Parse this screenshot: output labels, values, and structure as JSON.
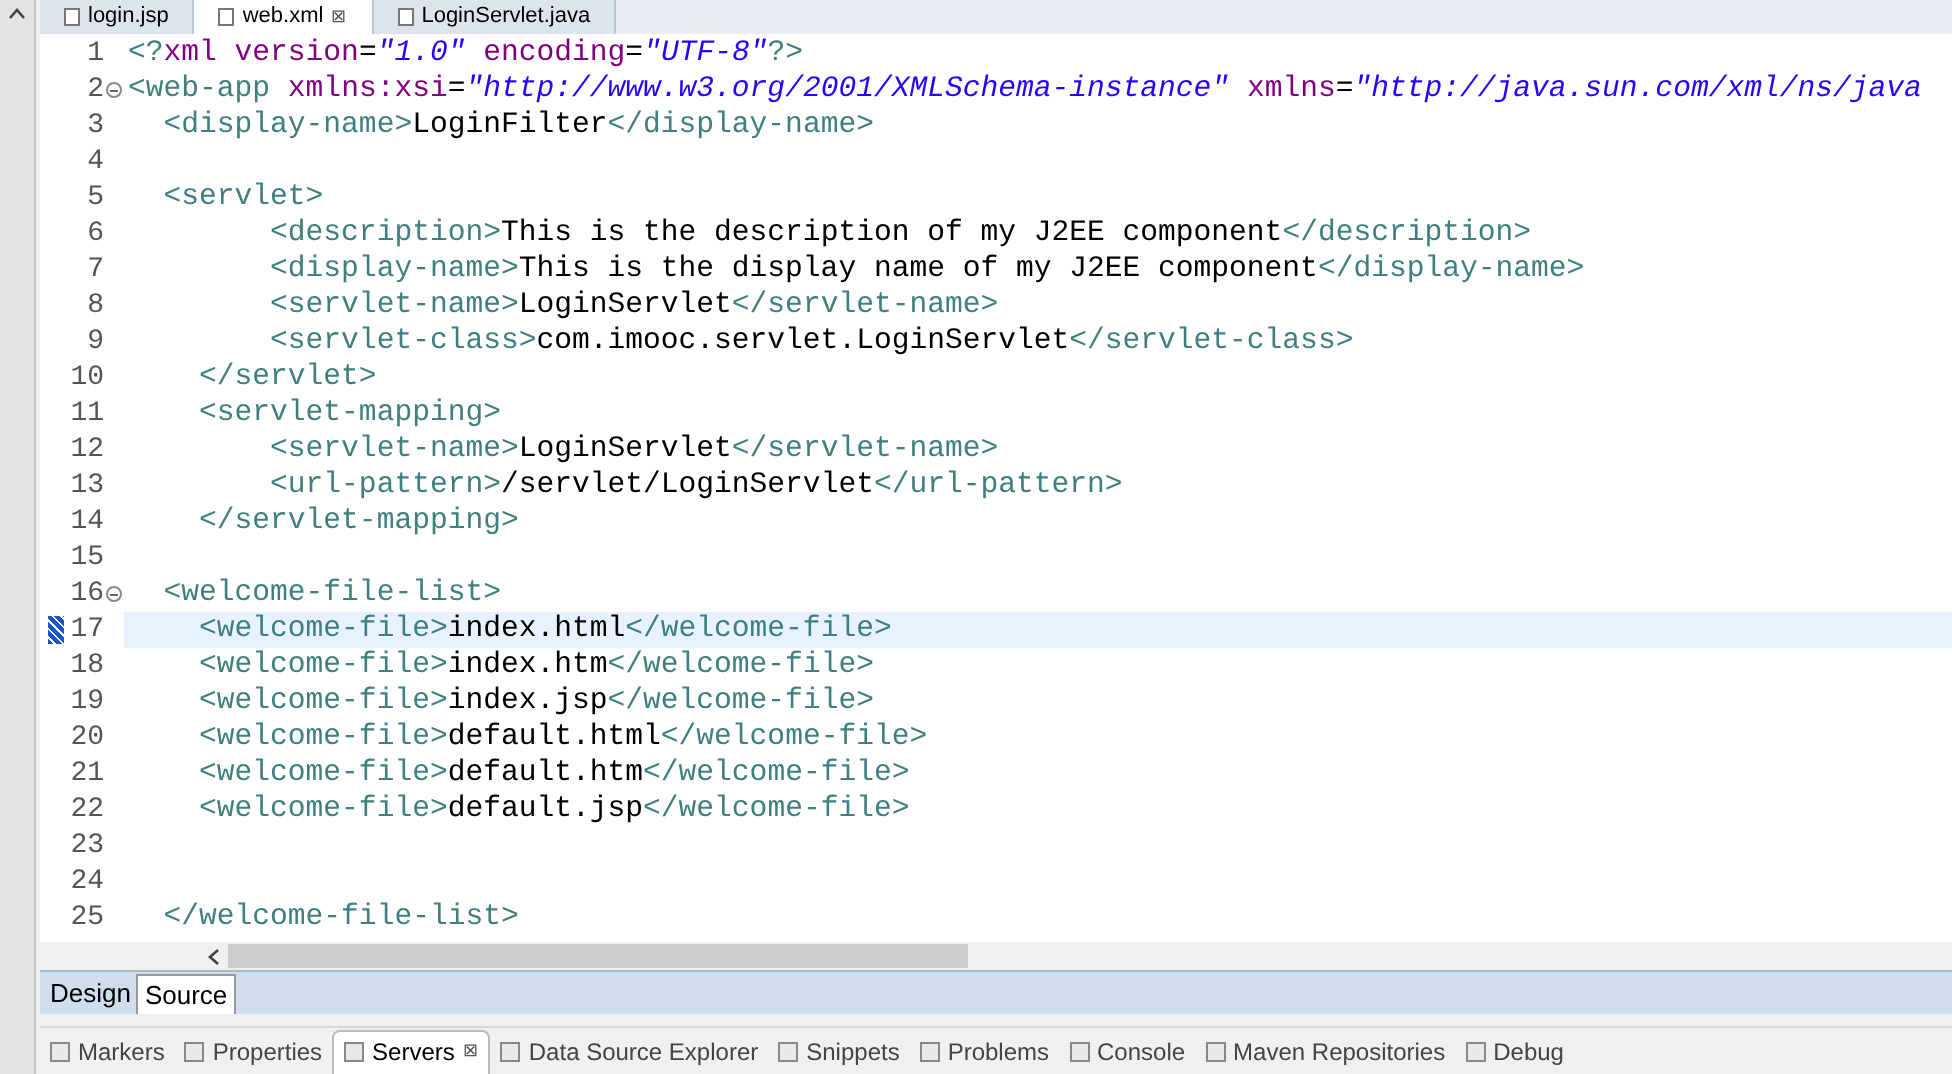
{
  "editor_tabs": [
    {
      "label": "login.jsp",
      "selected": false
    },
    {
      "label": "web.xml",
      "selected": true,
      "close": "⊠"
    },
    {
      "label": "LoginServlet.java",
      "selected": false
    }
  ],
  "lines": [
    {
      "number": "1",
      "fold": false,
      "current": false,
      "segments": [
        {
          "kind": "tag",
          "text": "<?"
        },
        {
          "kind": "attr",
          "text": "xml version"
        },
        {
          "kind": "plain",
          "text": "="
        },
        {
          "kind": "value",
          "text": "\"1.0\""
        },
        {
          "kind": "attr",
          "text": " encoding"
        },
        {
          "kind": "plain",
          "text": "="
        },
        {
          "kind": "value",
          "text": "\"UTF-8\""
        },
        {
          "kind": "tag",
          "text": "?>"
        }
      ]
    },
    {
      "number": "2",
      "fold": true,
      "current": false,
      "segments": [
        {
          "kind": "tag",
          "text": "<web-app"
        },
        {
          "kind": "attr",
          "text": " xmlns:xsi"
        },
        {
          "kind": "plain",
          "text": "="
        },
        {
          "kind": "value",
          "text": "\"http://www.w3.org/2001/XMLSchema-instance\""
        },
        {
          "kind": "attr",
          "text": " xmlns"
        },
        {
          "kind": "plain",
          "text": "="
        },
        {
          "kind": "value",
          "text": "\"http://java.sun.com/xml/ns/java"
        }
      ]
    },
    {
      "number": "3",
      "fold": false,
      "current": false,
      "segments": [
        {
          "kind": "tag",
          "text": "  <display-name>"
        },
        {
          "kind": "plain",
          "text": "LoginFilter"
        },
        {
          "kind": "tag",
          "text": "</display-name>"
        }
      ]
    },
    {
      "number": "4",
      "fold": false,
      "current": false
    },
    {
      "number": "5",
      "fold": false,
      "current": false,
      "segments": [
        {
          "kind": "tag",
          "text": "  <servlet>"
        }
      ]
    },
    {
      "number": "6",
      "fold": false,
      "current": false,
      "segments": [
        {
          "kind": "tag",
          "text": "        <description>"
        },
        {
          "kind": "plain",
          "text": "This is the description of my J2EE component"
        },
        {
          "kind": "tag",
          "text": "</description>"
        }
      ]
    },
    {
      "number": "7",
      "fold": false,
      "current": false,
      "segments": [
        {
          "kind": "tag",
          "text": "        <display-name>"
        },
        {
          "kind": "plain",
          "text": "This is the display name of my J2EE component"
        },
        {
          "kind": "tag",
          "text": "</display-name>"
        }
      ]
    },
    {
      "number": "8",
      "fold": false,
      "current": false,
      "segments": [
        {
          "kind": "tag",
          "text": "        <servlet-name>"
        },
        {
          "kind": "plain",
          "text": "LoginServlet"
        },
        {
          "kind": "tag",
          "text": "</servlet-name>"
        }
      ]
    },
    {
      "number": "9",
      "fold": false,
      "current": false,
      "segments": [
        {
          "kind": "tag",
          "text": "        <servlet-class>"
        },
        {
          "kind": "plain",
          "text": "com.imooc.servlet.LoginServlet"
        },
        {
          "kind": "tag",
          "text": "</servlet-class>"
        }
      ]
    },
    {
      "number": "10",
      "fold": false,
      "current": false,
      "segments": [
        {
          "kind": "tag",
          "text": "    </servlet>"
        }
      ]
    },
    {
      "number": "11",
      "fold": false,
      "current": false,
      "segments": [
        {
          "kind": "tag",
          "text": "    <servlet-mapping>"
        }
      ]
    },
    {
      "number": "12",
      "fold": false,
      "current": false,
      "segments": [
        {
          "kind": "tag",
          "text": "        <servlet-name>"
        },
        {
          "kind": "plain",
          "text": "LoginServlet"
        },
        {
          "kind": "tag",
          "text": "</servlet-name>"
        }
      ]
    },
    {
      "number": "13",
      "fold": false,
      "current": false,
      "segments": [
        {
          "kind": "tag",
          "text": "        <url-pattern>"
        },
        {
          "kind": "plain",
          "text": "/servlet/LoginServlet"
        },
        {
          "kind": "tag",
          "text": "</url-pattern>"
        }
      ]
    },
    {
      "number": "14",
      "fold": false,
      "current": false,
      "segments": [
        {
          "kind": "tag",
          "text": "    </servlet-mapping>"
        }
      ]
    },
    {
      "number": "15",
      "fold": false,
      "current": false
    },
    {
      "number": "16",
      "fold": true,
      "current": false,
      "segments": [
        {
          "kind": "tag",
          "text": "  <welcome-file-list>"
        }
      ]
    },
    {
      "number": "17",
      "fold": false,
      "current": true,
      "segments": [
        {
          "kind": "tag",
          "text": "    <welcome-file>"
        },
        {
          "kind": "plain",
          "text": "index.html"
        },
        {
          "kind": "tag",
          "text": "</welcome-file>"
        }
      ]
    },
    {
      "number": "18",
      "fold": false,
      "current": false,
      "segments": [
        {
          "kind": "tag",
          "text": "    <welcome-file>"
        },
        {
          "kind": "plain",
          "text": "index.htm"
        },
        {
          "kind": "tag",
          "text": "</welcome-file>"
        }
      ]
    },
    {
      "number": "19",
      "fold": false,
      "current": false,
      "segments": [
        {
          "kind": "tag",
          "text": "    <welcome-file>"
        },
        {
          "kind": "plain",
          "text": "index.jsp"
        },
        {
          "kind": "tag",
          "text": "</welcome-file>"
        }
      ]
    },
    {
      "number": "20",
      "fold": false,
      "current": false,
      "segments": [
        {
          "kind": "tag",
          "text": "    <welcome-file>"
        },
        {
          "kind": "plain",
          "text": "default.html"
        },
        {
          "kind": "tag",
          "text": "</welcome-file>"
        }
      ]
    },
    {
      "number": "21",
      "fold": false,
      "current": false,
      "segments": [
        {
          "kind": "tag",
          "text": "    <welcome-file>"
        },
        {
          "kind": "plain",
          "text": "default.htm"
        },
        {
          "kind": "tag",
          "text": "</welcome-file>"
        }
      ]
    },
    {
      "number": "22",
      "fold": false,
      "current": false,
      "segments": [
        {
          "kind": "tag",
          "text": "    <welcome-file>"
        },
        {
          "kind": "plain",
          "text": "default.jsp"
        },
        {
          "kind": "tag",
          "text": "</welcome-file>"
        }
      ]
    },
    {
      "number": "23",
      "fold": false,
      "current": false
    },
    {
      "number": "24",
      "fold": false,
      "current": false
    },
    {
      "number": "25",
      "fold": false,
      "current": false,
      "segments": [
        {
          "kind": "tag",
          "text": "  </welcome-file-list>"
        }
      ]
    }
  ],
  "mode_tabs": [
    {
      "label": "Design",
      "selected": false
    },
    {
      "label": "Source",
      "selected": true
    }
  ],
  "view_tabs": [
    {
      "label": "Markers",
      "selected": false
    },
    {
      "label": "Properties",
      "selected": false
    },
    {
      "label": "Servers",
      "selected": true,
      "close": "⊠"
    },
    {
      "label": "Data Source Explorer",
      "selected": false
    },
    {
      "label": "Snippets",
      "selected": false
    },
    {
      "label": "Problems",
      "selected": false
    },
    {
      "label": "Console",
      "selected": false
    },
    {
      "label": "Maven Repositories",
      "selected": false
    },
    {
      "label": "Debug",
      "selected": false
    }
  ]
}
